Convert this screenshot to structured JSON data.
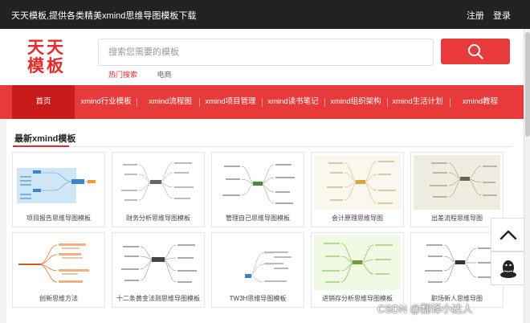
{
  "topbar": {
    "title": "天天模板,提供各类精美xmind思维导图模板下载",
    "register": "注册",
    "login": "登录"
  },
  "logo": {
    "line1": "天天",
    "line2": "模板"
  },
  "search": {
    "placeholder": "搜索您需要的模板"
  },
  "hot": {
    "label": "热门搜索",
    "item": "电商"
  },
  "nav": {
    "items": [
      {
        "label": "首页",
        "active": true
      },
      {
        "label": "xmind行业模板"
      },
      {
        "label": "xmind流程图"
      },
      {
        "label": "xmind项目管理"
      },
      {
        "label": "xmind读书笔记"
      },
      {
        "label": "xmind组织架构"
      },
      {
        "label": "xmind生活计划"
      },
      {
        "label": "xmind教程"
      }
    ]
  },
  "section": {
    "title": "最新xmind模板"
  },
  "cards": [
    {
      "label": "项目报告思维导图模板"
    },
    {
      "label": "财务分析思维导图模板"
    },
    {
      "label": "管理自己思维导图模板"
    },
    {
      "label": "会计原理思维导图"
    },
    {
      "label": "出差流程思维导图"
    },
    {
      "label": "创新思维方法"
    },
    {
      "label": "十二条黄金法则思维导图模板"
    },
    {
      "label": "TW3H思维导图模板"
    },
    {
      "label": "进销存分析思维导图模板"
    },
    {
      "label": "职场新人思维导图"
    }
  ],
  "watermark": "CSDN @翻译小达人",
  "colors": {
    "accent": "#e83a3a",
    "active_nav": "#c81c1c",
    "topbar": "#222222"
  },
  "icons": {
    "search": "search-icon",
    "up": "arrow-up-icon",
    "qq": "qq-icon"
  }
}
